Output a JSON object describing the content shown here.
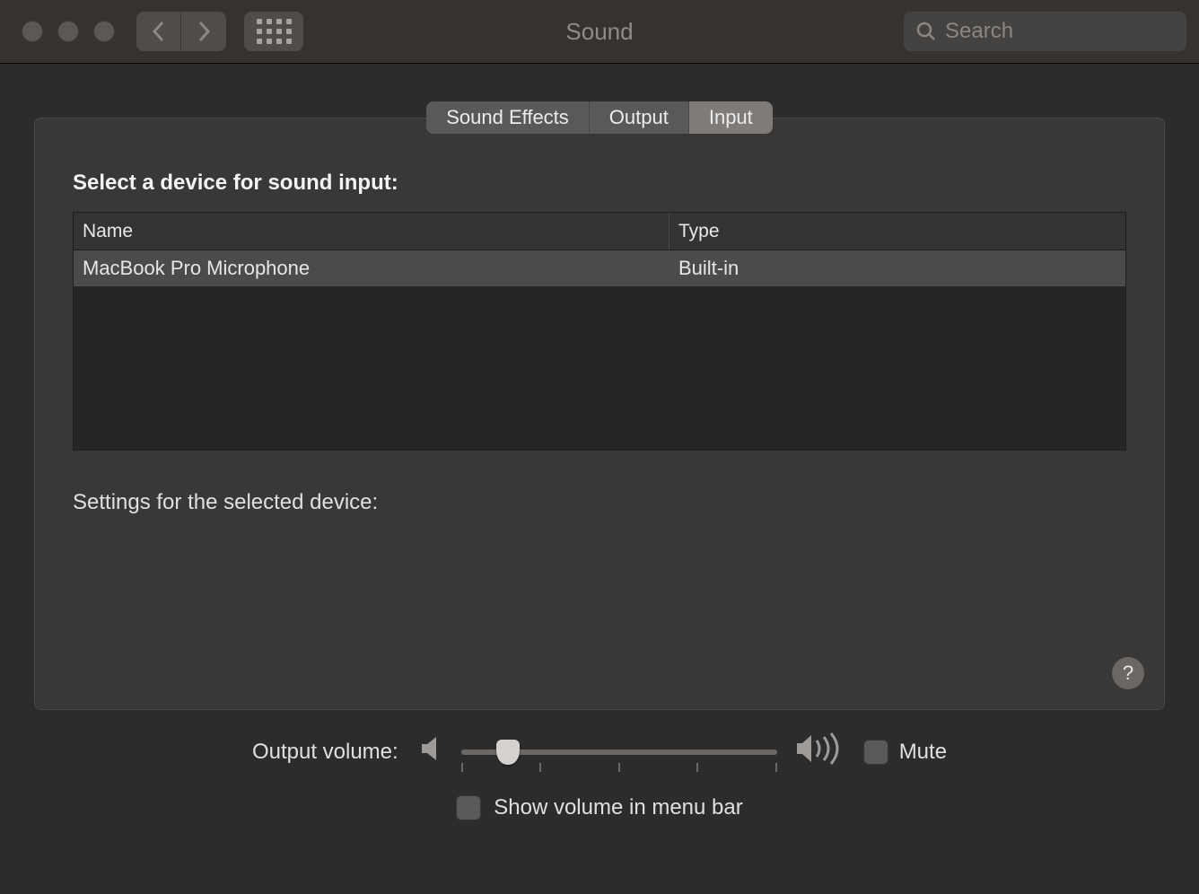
{
  "window": {
    "title": "Sound"
  },
  "search": {
    "placeholder": "Search"
  },
  "tabs": [
    {
      "label": "Sound Effects",
      "active": false
    },
    {
      "label": "Output",
      "active": false
    },
    {
      "label": "Input",
      "active": true
    }
  ],
  "panel": {
    "heading": "Select a device for sound input:",
    "columns": {
      "name": "Name",
      "type": "Type"
    },
    "devices": [
      {
        "name": "MacBook Pro Microphone",
        "type": "Built-in"
      }
    ],
    "settings_label": "Settings for the selected device:"
  },
  "footer": {
    "output_volume_label": "Output volume:",
    "volume_percent": 15,
    "mute_label": "Mute",
    "mute_checked": false,
    "show_volume_label": "Show volume in menu bar",
    "show_volume_checked": false
  },
  "help_symbol": "?"
}
